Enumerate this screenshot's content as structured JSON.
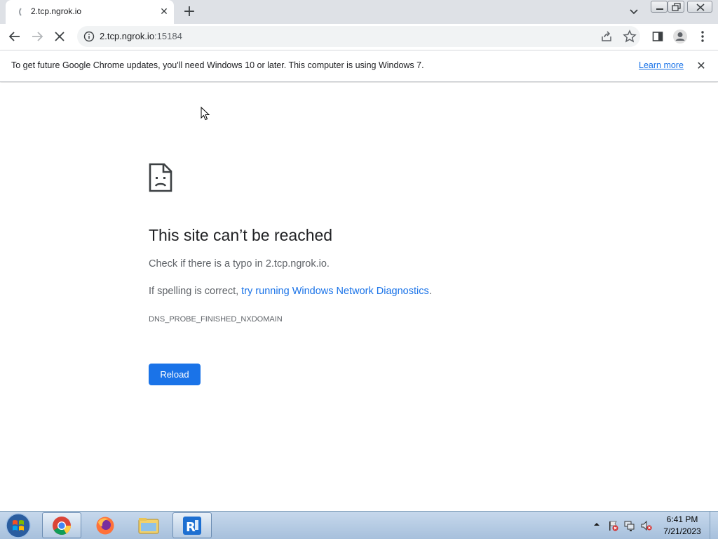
{
  "browser": {
    "tab": {
      "title": "2.tcp.ngrok.io",
      "loading": true
    },
    "address": {
      "host": "2.tcp.ngrok.io",
      "port": ":15184"
    }
  },
  "infobar": {
    "message": "To get future Google Chrome updates, you'll need Windows 10 or later. This computer is using Windows 7.",
    "link": "Learn more"
  },
  "error_page": {
    "title": "This site can’t be reached",
    "line1": "Check if there is a typo in 2.tcp.ngrok.io.",
    "line2_prefix": "If spelling is correct, ",
    "line2_link": "try running Windows Network Diagnostics",
    "line2_suffix": ".",
    "error_code": "DNS_PROBE_FINISHED_NXDOMAIN",
    "reload_label": "Reload"
  },
  "taskbar": {
    "apps": [
      {
        "name": "chrome-icon",
        "active": true
      },
      {
        "name": "firefox-icon",
        "active": false
      },
      {
        "name": "file-explorer-icon",
        "active": false
      },
      {
        "name": "remote-app-icon",
        "active": true
      }
    ],
    "clock": {
      "time": "6:41 PM",
      "date": "7/21/2023"
    }
  },
  "colors": {
    "accent": "#1a73e8",
    "tabstrip": "#dee1e6",
    "taskbar": "#b6cbe3"
  }
}
